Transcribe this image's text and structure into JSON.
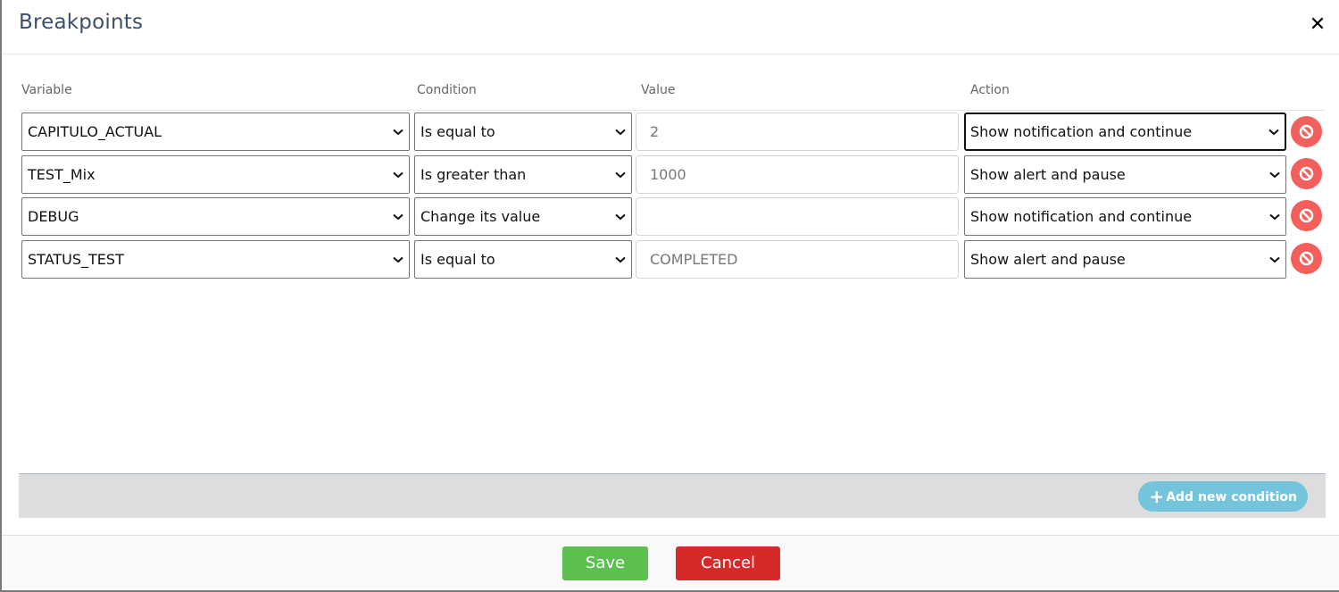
{
  "dialog": {
    "title": "Breakpoints",
    "close_icon": "close-icon"
  },
  "columns": {
    "variable": "Variable",
    "condition": "Condition",
    "value": "Value",
    "action": "Action"
  },
  "rows": [
    {
      "variable": "CAPITULO_ACTUAL",
      "condition": "Is equal to",
      "value": "2",
      "action": "Show notification and continue",
      "action_focused": true
    },
    {
      "variable": "TEST_Mix",
      "condition": "Is greater than",
      "value": "1000",
      "action": "Show alert and pause"
    },
    {
      "variable": "DEBUG",
      "condition": "Change its value",
      "value": "",
      "action": "Show notification and continue"
    },
    {
      "variable": "STATUS_TEST",
      "condition": "Is equal to",
      "value": "COMPLETED",
      "action": "Show alert and pause"
    }
  ],
  "toolbar": {
    "add_condition_label": "Add new condition"
  },
  "footer": {
    "save_label": "Save",
    "cancel_label": "Cancel"
  },
  "colors": {
    "title": "#3c4f6b",
    "delete": "#f25f5c",
    "add": "#74c5dc",
    "save": "#5cbf4f",
    "cancel": "#d42a2a"
  }
}
